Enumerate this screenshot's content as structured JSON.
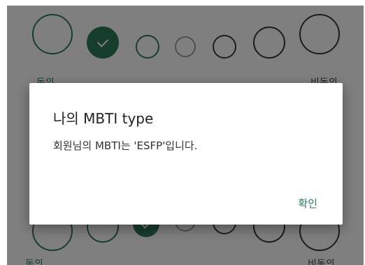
{
  "scale": {
    "left_label": "동의",
    "right_label": "비동의",
    "selected_index": 1
  },
  "dialog": {
    "title": "나의 MBTI type",
    "message": "회원님의 MBTI는 'ESFP'입니다.",
    "confirm_label": "확인"
  },
  "colors": {
    "accent": "#2e7d5b",
    "scrim": "rgba(0,0,0,0.5)"
  }
}
